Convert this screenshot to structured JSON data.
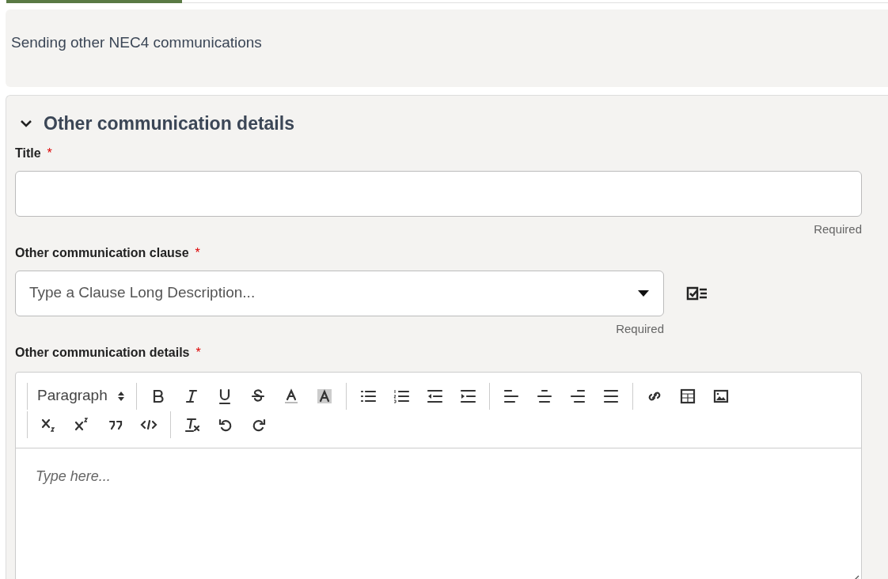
{
  "banner": {
    "text": "Sending other NEC4 communications"
  },
  "section": {
    "title": "Other communication details",
    "expanded": true,
    "fields": [
      {
        "kind": "text",
        "label": "Title",
        "required_mark": "*",
        "hint": "Required"
      },
      {
        "kind": "combo",
        "label": "Other communication clause",
        "required_mark": "*",
        "placeholder": "Type a Clause Long Description...",
        "hint": "Required"
      },
      {
        "kind": "editor",
        "label": "Other communication details",
        "required_mark": "*",
        "format": "Paragraph",
        "placeholder": "Type here..."
      }
    ]
  }
}
